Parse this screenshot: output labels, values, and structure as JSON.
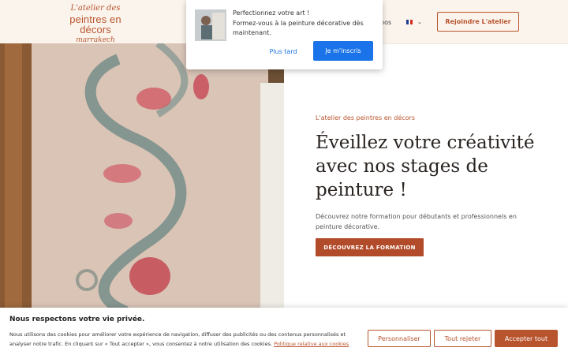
{
  "header": {
    "logo": {
      "line1": "L'atelier des",
      "line2": "peintres en décors",
      "line3": "marrakech"
    },
    "nav_fragment": "pos",
    "lang_flag_colors": [
      "#1f3b8f",
      "#ffffff",
      "#d52b1e"
    ],
    "join_button": "Rejoindre L'atelier"
  },
  "popup": {
    "title": "Perfectionnez votre art !",
    "message": "Formez-vous à la peinture décorative dès maintenant.",
    "later_button": "Plus tard",
    "signup_button": "Je m'inscris"
  },
  "hero": {
    "eyebrow": "L'atelier des peintres en décors",
    "headline": "Éveillez votre créativité avec nos stages de peinture !",
    "description": "Découvrez notre formation pour débutants et professionnels en peinture décorative.",
    "cta": "DÉCOUVREZ LA FORMATION"
  },
  "cookie": {
    "title": "Nous respectons votre vie privée.",
    "text": "Nous utilisons des cookies pour améliorer votre expérience de navigation, diffuser des publicités ou des contenus personnalisés et analyser notre trafic. En cliquant sur « Tout accepter », vous consentez à notre utilisation des cookies. ",
    "link": "Politique relative aux cookies",
    "customize_button": "Personnaliser",
    "reject_button": "Tout rejeter",
    "accept_button": "Accepter tout"
  },
  "colors": {
    "brand": "#b8542e",
    "popup_blue": "#1a73e8",
    "header_bg": "#fbf4ec"
  }
}
